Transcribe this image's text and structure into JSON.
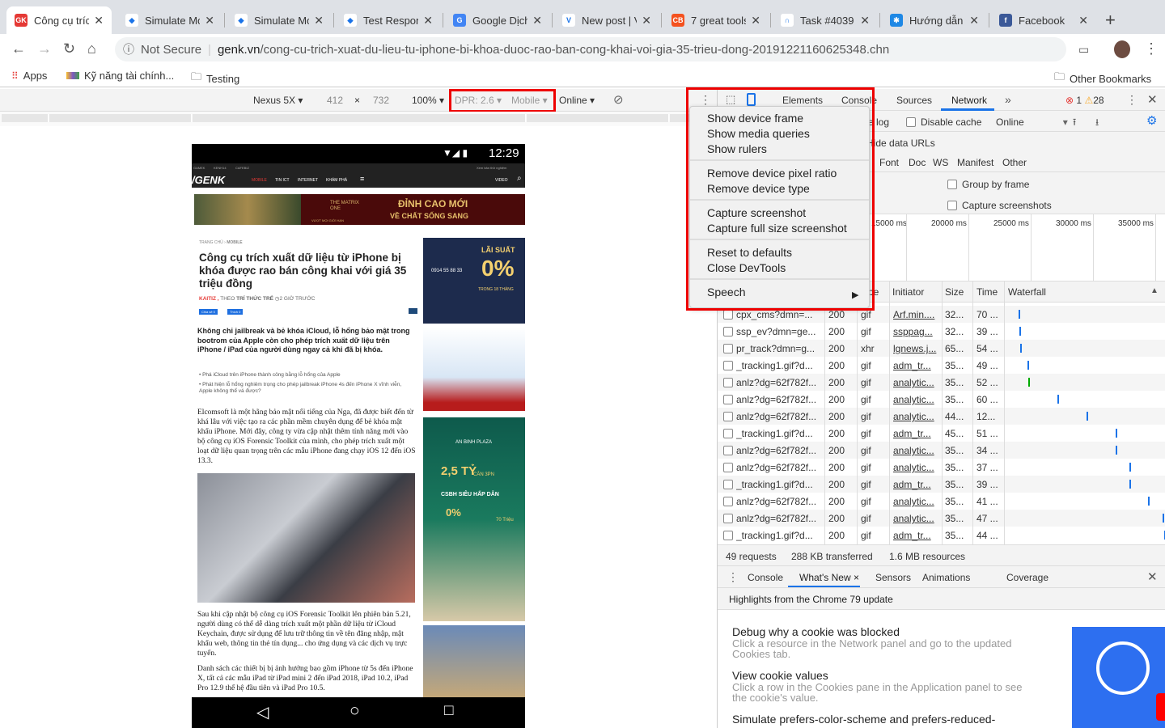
{
  "tabs": [
    {
      "title": "Công cụ trích",
      "color": "#e53935",
      "glyph": "GK",
      "active": true
    },
    {
      "title": "Simulate Mo",
      "color": "#fff",
      "glyph": "◆"
    },
    {
      "title": "Simulate Mo",
      "color": "#fff",
      "glyph": "◆"
    },
    {
      "title": "Test Respon",
      "color": "#fff",
      "glyph": "◆"
    },
    {
      "title": "Google Dịch",
      "color": "#4285f4",
      "glyph": "G"
    },
    {
      "title": "New post | V",
      "color": "#fff",
      "glyph": "V"
    },
    {
      "title": "7 great tools",
      "color": "#f4511e",
      "glyph": "CB"
    },
    {
      "title": "Task #4039",
      "color": "#fff",
      "glyph": "∩"
    },
    {
      "title": "Hướng dẫn",
      "color": "#1e88e5",
      "glyph": "✱"
    },
    {
      "title": "Facebook",
      "color": "#3b5998",
      "glyph": "f"
    }
  ],
  "address": {
    "security": "Not Secure",
    "domain": "genk.vn",
    "path": "/cong-cu-trich-xuat-du-lieu-tu-iphone-bi-khoa-duoc-rao-ban-cong-khai-voi-gia-35-trieu-dong-20191221160625348.chn"
  },
  "bookmarks": {
    "apps": "Apps",
    "items": [
      "Kỹ năng tài chính...",
      "Testing"
    ],
    "other": "Other Bookmarks"
  },
  "device_toolbar": {
    "device": "Nexus 5X ▾",
    "width": "412",
    "x": "×",
    "height": "732",
    "zoom": "100% ▾",
    "dpr": "DPR: 2.6 ▾",
    "type": "Mobile ▾",
    "throttle": "Online ▾"
  },
  "phone": {
    "time": "12:29",
    "topnav": [
      "GAMEK",
      "KENH14",
      "CAFEBIZ"
    ],
    "toggle_label": "Xem bản thử nghiệm",
    "logo": "/GENK",
    "nav": [
      "MOBILE",
      "TIN ICT",
      "INTERNET",
      "KHÁM PHÁ"
    ],
    "video": "VIDEO",
    "banner": {
      "brand": "THE MATRIX ONE",
      "tagline": "VƯỢT MỌI GIỚI HẠN",
      "line1": "ĐỈNH CAO MỚI",
      "line2": "VỀ CHẤT SỐNG SANG"
    },
    "breadcrumb": [
      "TRANG CHỦ",
      "MOBILE"
    ],
    "title": "Công cụ trích xuất dữ liệu từ iPhone bị khóa được rao bán công khai với giá 35 triệu đồng",
    "author": "KAITIZ ,",
    "source_prefix": "THEO",
    "source": "TRÍ THỨC TRẺ",
    "time_ago": "2 GIỜ TRƯỚC",
    "share": "Chia sẻ 0",
    "like": "Thích 0",
    "sapo": "Không chỉ jailbreak và bẻ khóa iCloud, lỗ hổng bảo mật trong bootrom của Apple còn cho phép trích xuất dữ liệu trên iPhone / iPad của người dùng ngay cả khi đã bị khóa.",
    "related": [
      "Phá iCloud trên iPhone thành công bằng lỗ hổng của Apple",
      "Phát hiện lỗ hổng nghiêm trọng cho phép jailbreak iPhone 4s đến iPhone X vĩnh viễn, Apple không thể vá được?"
    ],
    "p1": "Elcomsoft là một hãng bảo mật nổi tiếng của Nga, đã được biết đến từ khá lâu với việc tạo ra các phần mềm chuyên dụng để bẻ khóa mật khẩu iPhone. Mới đây, công ty vừa cập nhật thêm tính năng mới vào bộ công cụ iOS Forensic Toolkit của mình, cho phép trích xuất một loạt dữ liệu quan trọng trên các mẫu iPhone đang chạy iOS 12 đến iOS 13.3.",
    "p2": "Sau khi cập nhật bộ công cụ iOS Forensic Toolkit lên phiên bản 5.21, người dùng có thể dễ dàng trích xuất một phần dữ liệu từ iCloud Keychain, được sử dụng để lưu trữ thông tin về tên đăng nhập, mật khẩu web, thông tin thẻ tín dụng... cho ứng dụng và các dịch vụ trực tuyến.",
    "p3": "Danh sách các thiết bị bị ảnh hưởng bao gồm iPhone từ 5s đến iPhone X, tất cả các mẫu iPad từ iPad mini 2 đến iPad 2018, iPad 10.2, iPad Pro 12.9 thế hệ đầu tiên và iPad Pro 10.5.",
    "ad1": {
      "top": "LÃI SUẤT",
      "big": "0%",
      "sub": "TRONG 18 THÁNG",
      "phone": "0914 55 88 33"
    },
    "ad3": {
      "name": "AN BINH PLAZA",
      "price": "2,5 TỶ",
      "sub": "CĂN 3PN",
      "tag": "CSBH SIÊU HẤP DẪN",
      "rate": "0%",
      "gift": "70 Triệu"
    }
  },
  "devtools": {
    "tabs": [
      "Elements",
      "Console",
      "Sources",
      "Network"
    ],
    "errors": "1",
    "warnings": "28",
    "preserve": "e log",
    "disable_cache": "Disable cache",
    "online": "Online",
    "hide_data_urls": "Hide data URLs",
    "types": [
      "a",
      "Font",
      "Doc",
      "WS",
      "Manifest",
      "Other"
    ],
    "group_by_frame": "Group by frame",
    "capture_screenshots": "Capture screenshots",
    "ticks": [
      "15000 ms",
      "20000 ms",
      "25000 ms",
      "30000 ms",
      "35000 ms"
    ],
    "columns": [
      "pe",
      "Initiator",
      "Size",
      "Time",
      "Waterfall"
    ],
    "rows": [
      [
        "cpx_cms?dmn=...",
        "200",
        "gif",
        "Arf.min....",
        "32...",
        "70 ..."
      ],
      [
        "ssp_ev?dmn=ge...",
        "200",
        "gif",
        "ssppag...",
        "32...",
        "39 ..."
      ],
      [
        "pr_track?dmn=g...",
        "200",
        "xhr",
        "lgnews.j...",
        "65...",
        "54 ..."
      ],
      [
        "_tracking1.gif?d...",
        "200",
        "gif",
        "adm_tr...",
        "35...",
        "49 ..."
      ],
      [
        "anlz?dg=62f782f...",
        "200",
        "gif",
        "analytic...",
        "35...",
        "52 ..."
      ],
      [
        "anlz?dg=62f782f...",
        "200",
        "gif",
        "analytic...",
        "35...",
        "60 ..."
      ],
      [
        "anlz?dg=62f782f...",
        "200",
        "gif",
        "analytic...",
        "44...",
        "12..."
      ],
      [
        "_tracking1.gif?d...",
        "200",
        "gif",
        "adm_tr...",
        "45...",
        "51 ..."
      ],
      [
        "anlz?dg=62f782f...",
        "200",
        "gif",
        "analytic...",
        "35...",
        "34 ..."
      ],
      [
        "anlz?dg=62f782f...",
        "200",
        "gif",
        "analytic...",
        "35...",
        "37 ..."
      ],
      [
        "_tracking1.gif?d...",
        "200",
        "gif",
        "adm_tr...",
        "35...",
        "39 ..."
      ],
      [
        "anlz?dg=62f782f...",
        "200",
        "gif",
        "analytic...",
        "35...",
        "41 ..."
      ],
      [
        "anlz?dg=62f782f...",
        "200",
        "gif",
        "analytic...",
        "35...",
        "47 ..."
      ],
      [
        "_tracking1.gif?d...",
        "200",
        "gif",
        "adm_tr...",
        "35...",
        "44 ..."
      ]
    ],
    "summary": [
      "49 requests",
      "288 KB transferred",
      "1.6 MB resources"
    ],
    "drawer_tabs": [
      "Console",
      "What's New",
      "Sensors",
      "Animations",
      "Coverage"
    ],
    "highlights": "Highlights from the Chrome 79 update",
    "news": [
      {
        "title": "Debug why a cookie was blocked",
        "desc": "Click a resource in the Network panel and go to the updated Cookies tab."
      },
      {
        "title": "View cookie values",
        "desc": "Click a row in the Cookies pane in the Application panel to see the cookie's value."
      },
      {
        "title": "Simulate prefers-color-scheme and prefers-reduced-",
        "desc": ""
      }
    ]
  },
  "menu": {
    "groups": [
      [
        "Show device frame",
        "Show media queries",
        "Show rulers"
      ],
      [
        "Remove device pixel ratio",
        "Remove device type"
      ],
      [
        "Capture screenshot",
        "Capture full size screenshot"
      ],
      [
        "Reset to defaults",
        "Close DevTools"
      ],
      [
        "Speech"
      ]
    ]
  }
}
